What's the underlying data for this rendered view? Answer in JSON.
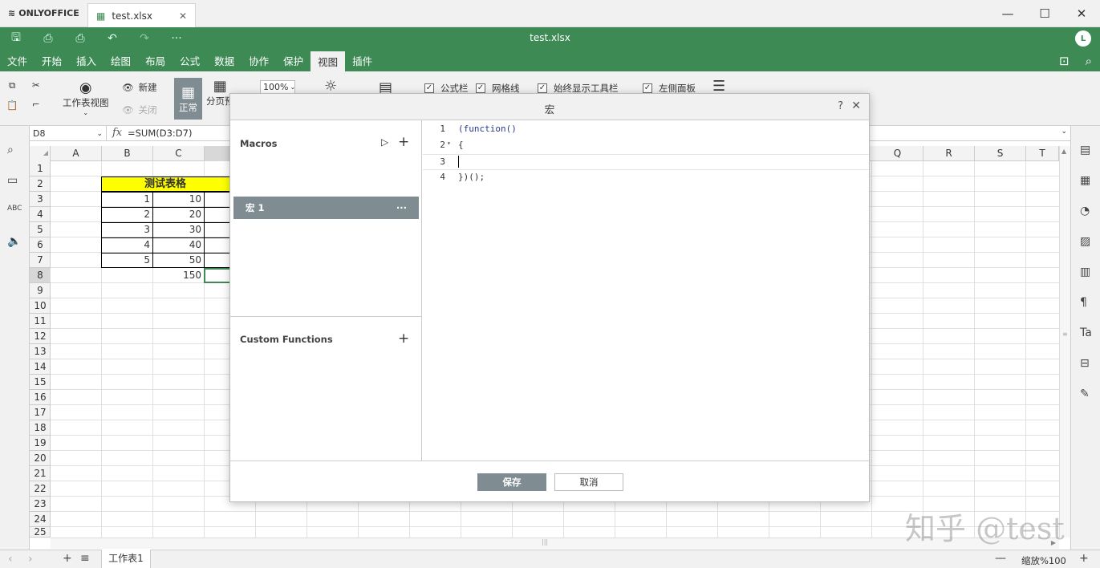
{
  "app": {
    "brand": "ONLYOFFICE",
    "tab_title": "test.xlsx",
    "doc_title": "test.xlsx",
    "avatar": "L"
  },
  "menu": [
    "文件",
    "开始",
    "插入",
    "绘图",
    "布局",
    "公式",
    "数据",
    "协作",
    "保护",
    "视图",
    "插件"
  ],
  "active_menu_index": 9,
  "toolbar": {
    "sheet_view": "工作表视图",
    "new": "新建",
    "close": "关闭",
    "normal": "正常",
    "page_break": "分页预",
    "zoom": "100%",
    "checks": [
      "公式栏",
      "网格线",
      "始终显示工具栏",
      "左侧面板"
    ]
  },
  "formula_bar": {
    "cell": "D8",
    "fx": "fx",
    "formula": "=SUM(D3:D7)"
  },
  "columns_left": [
    "A",
    "B",
    "C"
  ],
  "columns_right": [
    "Q",
    "R",
    "S",
    "T"
  ],
  "rows": [
    "1",
    "2",
    "3",
    "4",
    "5",
    "6",
    "7",
    "8",
    "9",
    "10",
    "11",
    "12",
    "13",
    "14",
    "15",
    "16",
    "17",
    "18",
    "19",
    "20",
    "21",
    "22",
    "23",
    "24",
    "25"
  ],
  "sheet": {
    "title": "测试表格",
    "b": [
      "1",
      "2",
      "3",
      "4",
      "5"
    ],
    "c": [
      "10",
      "20",
      "30",
      "40",
      "50"
    ],
    "total": "150"
  },
  "status": {
    "sheet_tab": "工作表1",
    "zoom": "缩放%100"
  },
  "dialog": {
    "title": "宏",
    "help": "?",
    "macros_label": "Macros",
    "macro_item": "宏 1",
    "more": "···",
    "custom_functions_label": "Custom Functions",
    "code_lines": [
      "(function()",
      "{",
      "",
      "})();"
    ],
    "line_numbers": [
      "1",
      "2",
      "3",
      "4"
    ],
    "save": "保存",
    "cancel": "取消"
  },
  "watermark": "知乎 @test",
  "colors": {
    "brand_green": "#3d8a54",
    "title_fill": "#ffff00",
    "dialog_selected": "#7f8c92"
  }
}
